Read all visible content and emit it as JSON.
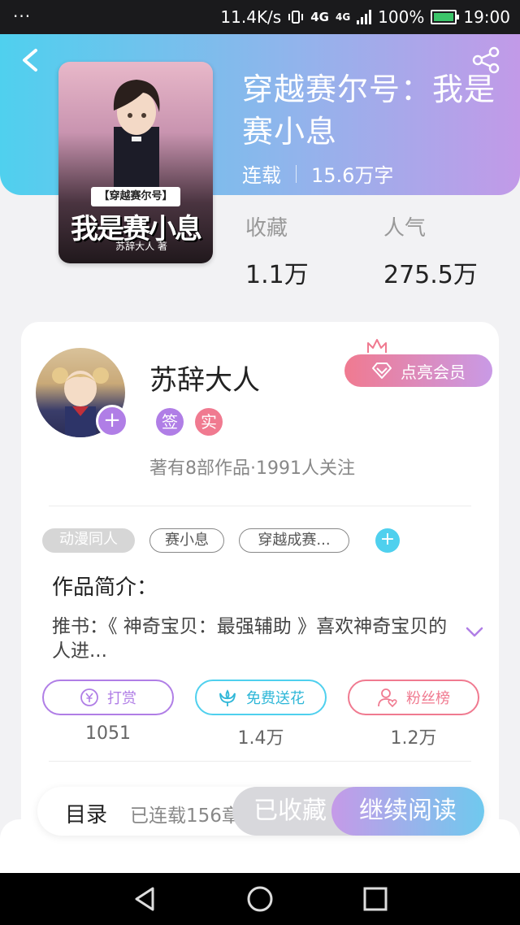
{
  "status_bar": {
    "left": "···",
    "speed": "11.4K/s",
    "network_1": "4G",
    "network_2": "4G",
    "battery": "100%",
    "time": "19:00"
  },
  "icons": {
    "back": "chevron-left-icon",
    "share": "share-icon",
    "crown": "crown-icon",
    "diamond": "diamond-icon",
    "expand": "chevron-down-icon",
    "reward": "yen-icon",
    "flower": "flower-icon",
    "fans": "user-heart-icon",
    "nav_back": "triangle-back-icon",
    "nav_home": "circle-home-icon",
    "nav_recent": "square-recent-icon"
  },
  "colors": {
    "header_start": "#4fd0ee",
    "header_end": "#c29ae8",
    "purple": "#b07ee6",
    "cyan": "#4fd0ee",
    "pink": "#f07a90"
  },
  "book": {
    "title": "穿越赛尔号：我是赛小息",
    "status": "连载",
    "word_count": "15.6万字",
    "cover": {
      "subtitle": "【穿越赛尔号】",
      "title": "我是赛小息",
      "author": "苏辞大人 著"
    }
  },
  "stats": {
    "collect_label": "收藏",
    "collect_value": "1.1万",
    "popularity_label": "人气",
    "popularity_value": "275.5万"
  },
  "author": {
    "name": "苏辞大人",
    "badge_signed": "签",
    "badge_verified": "实",
    "summary": "著有8部作品·1991人关注",
    "plus": "+",
    "vip_button": "点亮会员"
  },
  "tags": [
    "动漫同人",
    "赛小息",
    "穿越成赛..."
  ],
  "tag_add": "+",
  "intro": {
    "title": "作品简介：",
    "text": "推书：《 神奇宝贝：最强辅助 》喜欢神奇宝贝的人进..."
  },
  "actions": [
    {
      "label": "打赏",
      "count": "1051"
    },
    {
      "label": "免费送花",
      "count": "1.4万"
    },
    {
      "label": "粉丝榜",
      "count": "1.2万"
    }
  ],
  "bottom_bar": {
    "toc": "目录",
    "toc_info": "已连载156章",
    "collected": "已收藏",
    "read": "继续阅读"
  }
}
